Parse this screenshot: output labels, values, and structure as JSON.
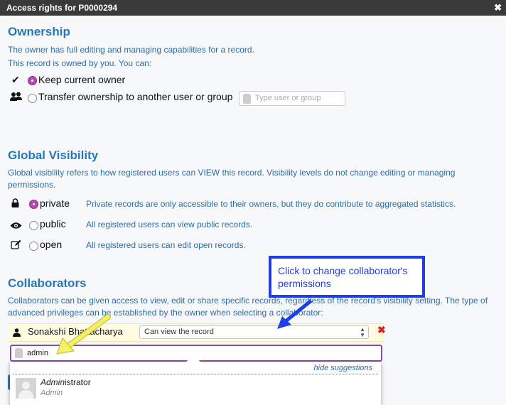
{
  "window": {
    "title": "Access rights for P0000294",
    "close_icon": "close-icon"
  },
  "ownership": {
    "heading": "Ownership",
    "desc1": "The owner has full editing and managing capabilities for a record.",
    "desc2": "This record is owned by you. You can:",
    "options": [
      {
        "label": "Keep current owner",
        "selected": true,
        "icon": "checkmark-icon"
      },
      {
        "label": "Transfer ownership to another user or group",
        "selected": false,
        "icon": "users-group-icon"
      }
    ],
    "transfer_placeholder": "Type user or group"
  },
  "visibility": {
    "heading": "Global Visibility",
    "desc": "Global visibility refers to how registered users can VIEW this record. Visibility levels do not change editing or managing permissions.",
    "options": [
      {
        "label": "private",
        "selected": true,
        "icon": "lock-icon",
        "desc": "Private records are only accessible to their owners, but they do contribute to aggregated statistics."
      },
      {
        "label": "public",
        "selected": false,
        "icon": "eye-icon",
        "desc": "All registered users can view public records."
      },
      {
        "label": "open",
        "selected": false,
        "icon": "edit-icon",
        "desc": "All registered users can edit open records."
      }
    ]
  },
  "collaborators": {
    "heading": "Collaborators",
    "desc": "Collaborators can be given access to view, edit or share specific records, regardless of the record's visibility setting. The type of advanced privileges can be established by the owner when selecting a collaborator:",
    "entries": [
      {
        "name": "Sonakshi Bhattacharya",
        "permission": "Can view the record"
      }
    ],
    "search_value": "admin",
    "hide_suggestions": "hide suggestions",
    "suggestions": [
      {
        "name_match": "Admin",
        "name_rest": "istrator",
        "subtitle": "Admin"
      }
    ]
  },
  "annotation": {
    "callout": "Click to change collaborator's permissions"
  },
  "colors": {
    "heading": "#2878b8",
    "text": "#2e6da4",
    "accent_radio": "#b44ab0",
    "callout": "#1f3fe6",
    "arrow_yellow": "#f4f06a"
  }
}
